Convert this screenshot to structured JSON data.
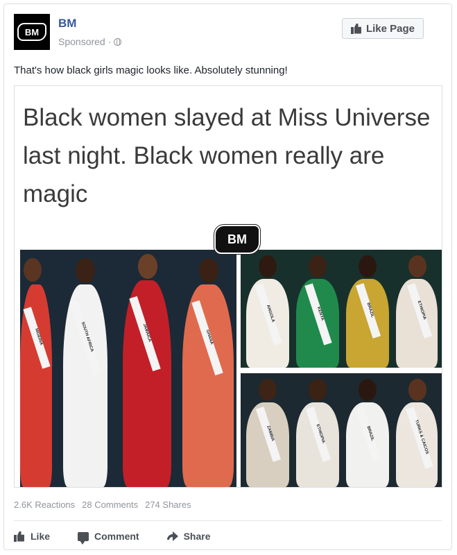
{
  "post": {
    "page_name": "BM",
    "avatar_text": "BM",
    "sponsored_label": "Sponsored",
    "meta_separator": "·",
    "like_page_label": "Like Page",
    "text": "That's how black girls magic looks like. Absolutely stunning!"
  },
  "media": {
    "headline": "Black women slayed at Miss Universe last night. Black women really are magic",
    "logo_text": "BM",
    "sash_labels": [
      "NIGERIA",
      "SOUTH AFRICA",
      "JAMAICA",
      "GHANA",
      "ANGOLA",
      "KENYA",
      "BRAZIL",
      "ETHIOPIA",
      "ZAMBIA",
      "TURKS & CAICOS"
    ]
  },
  "stats": {
    "reactions": "2.6K Reactions",
    "comments": "28 Comments",
    "shares": "274 Shares"
  },
  "actions": {
    "like": "Like",
    "comment": "Comment",
    "share": "Share"
  },
  "colors": {
    "link_blue": "#365899",
    "muted_text": "#90949c",
    "action_text": "#4b4f56"
  }
}
